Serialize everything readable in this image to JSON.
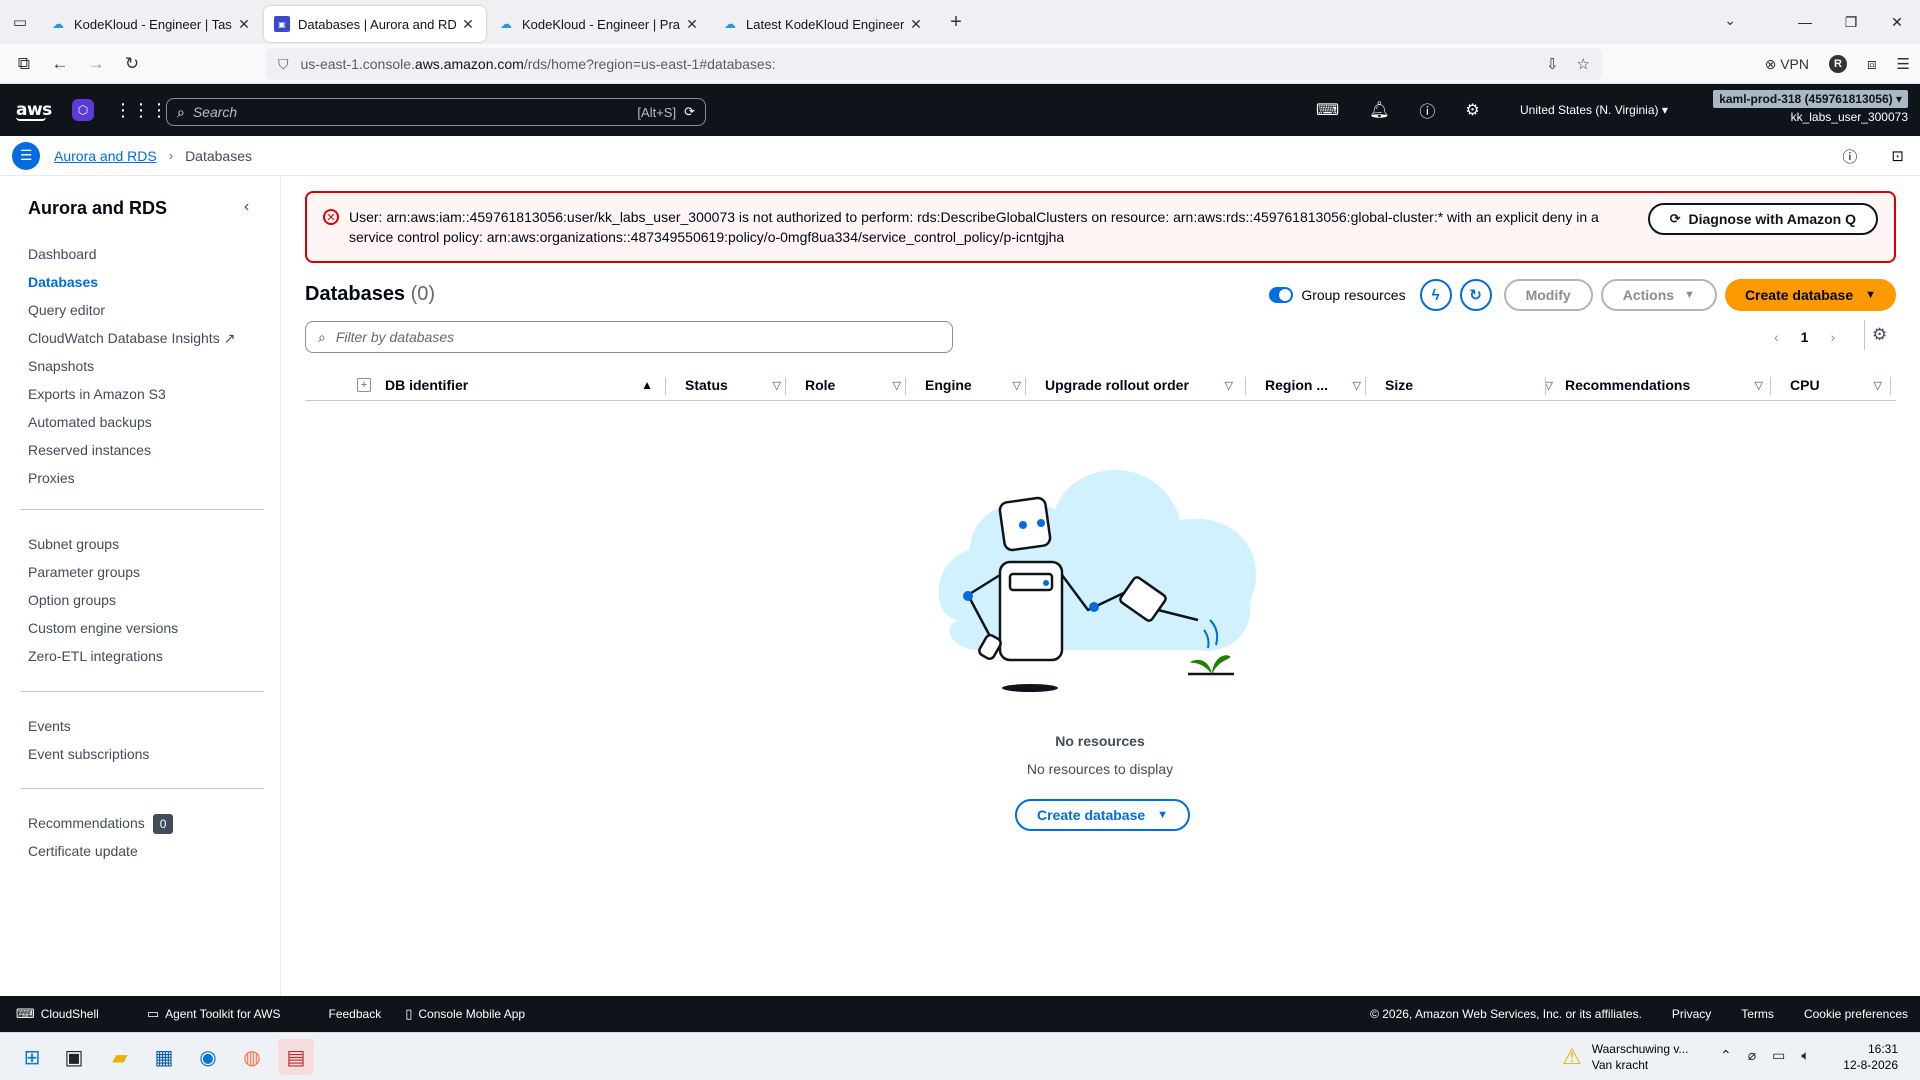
{
  "browser": {
    "tabs": [
      {
        "title": "KodeKloud - Engineer | Task",
        "favicon": "kodekloud-icon",
        "active": false
      },
      {
        "title": "Databases | Aurora and RDS | ",
        "favicon": "rds-icon",
        "active": true
      },
      {
        "title": "KodeKloud - Engineer | Practice",
        "favicon": "kodekloud-icon",
        "active": false
      },
      {
        "title": "Latest KodeKloud Engineer top",
        "favicon": "kodekloud-icon",
        "active": false
      }
    ],
    "url_prefix": "us-east-1.console.",
    "url_domain": "aws.amazon.com",
    "url_suffix": "/rds/home?region=us-east-1#databases:",
    "vpn_label": "VPN",
    "profile_initial": "R"
  },
  "aws_header": {
    "logo_text": "aws",
    "search_placeholder": "Search",
    "search_shortcut": "[Alt+S]",
    "region": "United States (N. Virginia)",
    "account_badge": "kaml-prod-318 (459761813056)",
    "username": "kk_labs_user_300073"
  },
  "breadcrumb": {
    "parent": "Aurora and RDS",
    "current": "Databases"
  },
  "sidebar": {
    "title": "Aurora and RDS",
    "group1": [
      "Dashboard",
      "Databases",
      "Query editor",
      "CloudWatch Database Insights",
      "Snapshots",
      "Exports in Amazon S3",
      "Automated backups",
      "Reserved instances",
      "Proxies"
    ],
    "group2": [
      "Subnet groups",
      "Parameter groups",
      "Option groups",
      "Custom engine versions",
      "Zero-ETL integrations"
    ],
    "group3": [
      "Events",
      "Event subscriptions"
    ],
    "group4": [
      "Recommendations",
      "Certificate update"
    ],
    "recommendations_count": "0",
    "active_item": "Databases"
  },
  "alert": {
    "message": "User: arn:aws:iam::459761813056:user/kk_labs_user_300073 is not authorized to perform: rds:DescribeGlobalClusters on resource: arn:aws:rds::459761813056:global-cluster:* with an explicit deny in a service control policy: arn:aws:organizations::487349550619:policy/o-0mgf8ua334/service_control_policy/p-icntgjha",
    "button_label": "Diagnose with Amazon Q"
  },
  "databases": {
    "title": "Databases",
    "count": "(0)",
    "group_resources_label": "Group resources",
    "modify_label": "Modify",
    "actions_label": "Actions",
    "create_label": "Create database",
    "filter_placeholder": "Filter by databases",
    "page_number": "1",
    "columns": [
      "DB identifier",
      "Status",
      "Role",
      "Engine",
      "Upgrade rollout order",
      "Region ...",
      "Size",
      "Recommendations",
      "CPU"
    ],
    "empty_title": "No resources",
    "empty_subtitle": "No resources to display",
    "empty_button": "Create database"
  },
  "footer": {
    "cloudshell": "CloudShell",
    "agent_toolkit": "Agent Toolkit for AWS",
    "feedback": "Feedback",
    "mobile_app": "Console Mobile App",
    "copyright": "© 2026, Amazon Web Services, Inc. or its affiliates.",
    "privacy": "Privacy",
    "terms": "Terms",
    "cookies": "Cookie preferences"
  },
  "taskbar": {
    "warning_line1": "Waarschuwing v...",
    "warning_line2": "Van kracht",
    "time": "16:31",
    "date": "12-8-2026"
  },
  "colors": {
    "aws_dark": "#0f141a",
    "link_blue": "#006ce0",
    "primary_orange": "#ff9900",
    "error_red": "#db0000"
  }
}
